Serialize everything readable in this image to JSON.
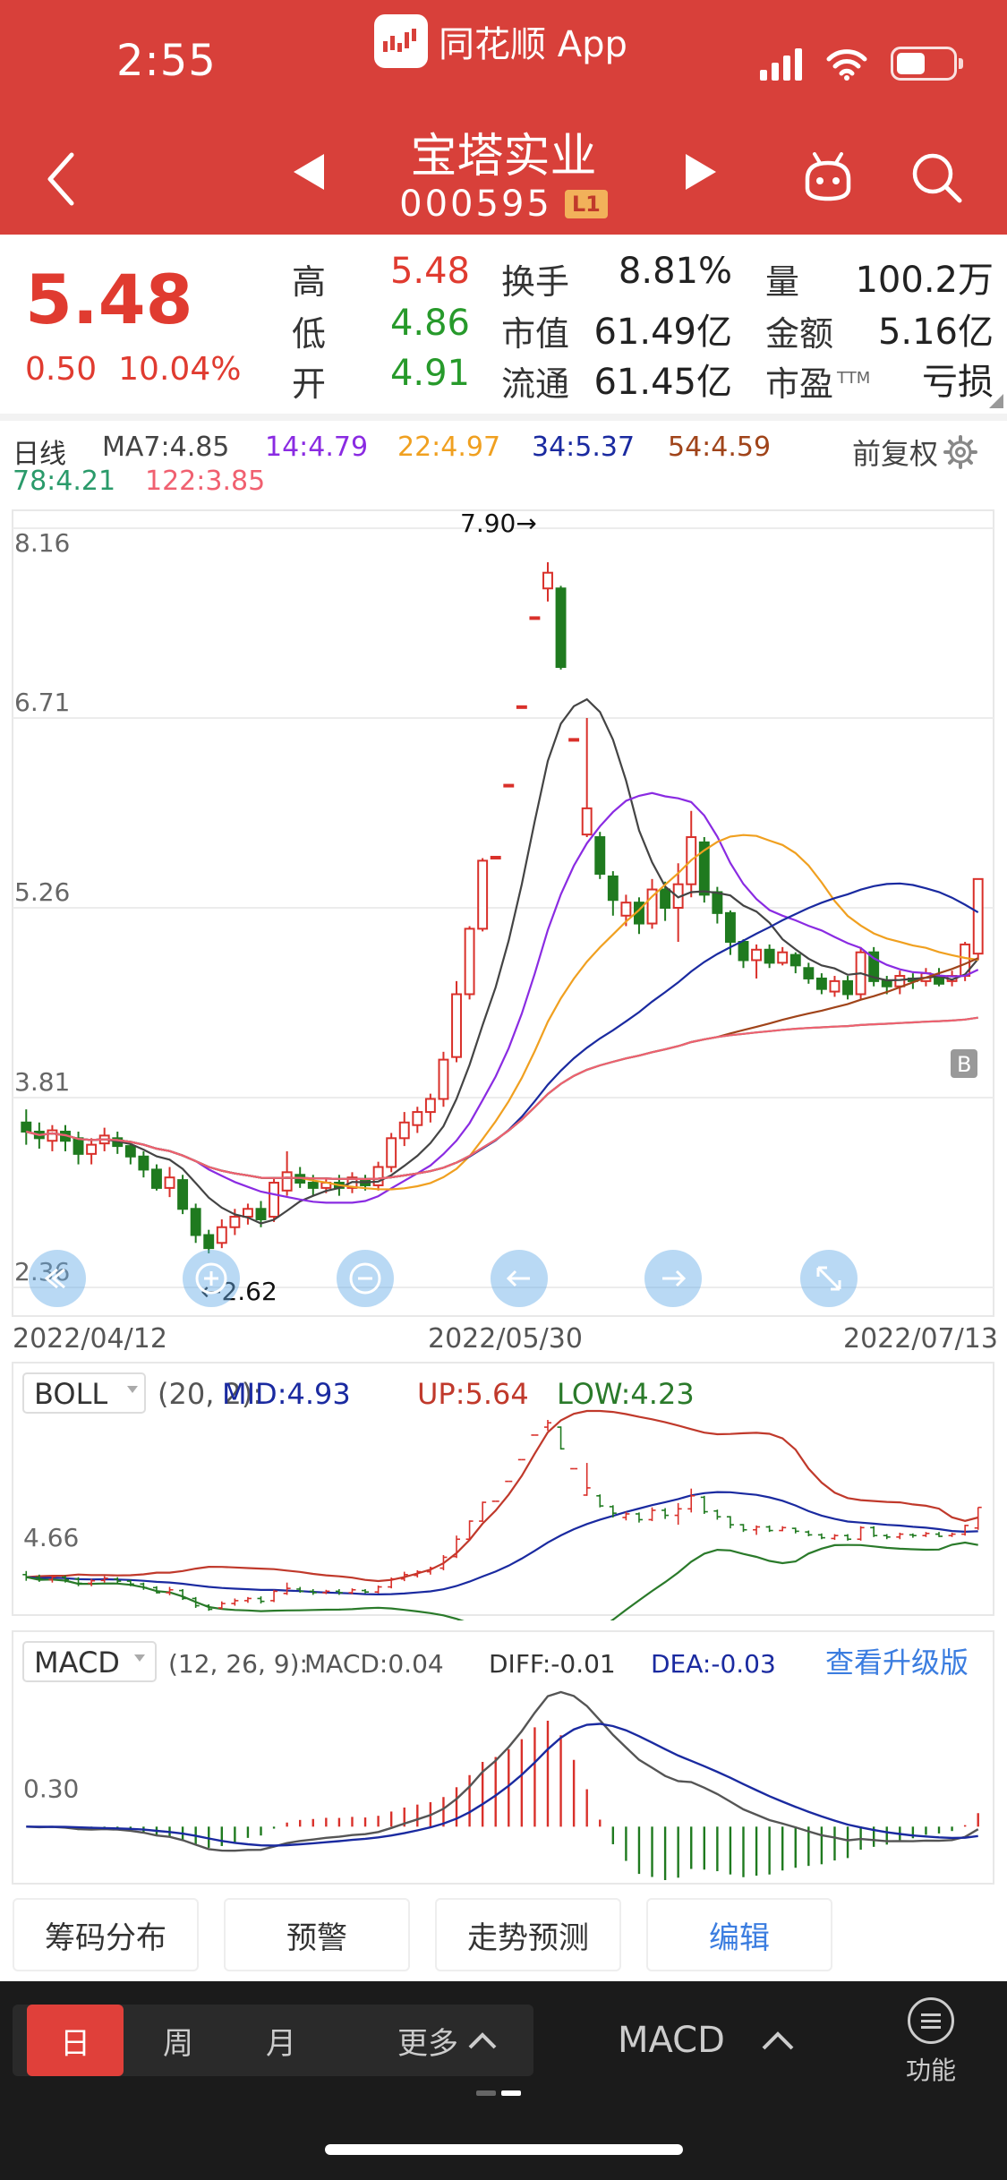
{
  "status": {
    "time": "2:55"
  },
  "app": {
    "name": "同花顺 App"
  },
  "stock": {
    "name": "宝塔实业",
    "code": "000595",
    "level": "L1"
  },
  "quote": {
    "price": "5.48",
    "change": "0.50",
    "change_pct": "10.04%",
    "rows": [
      {
        "l1": "高",
        "v1": "5.48",
        "c1": "red",
        "l2": "换手",
        "v2": "8.81%",
        "l3": "量",
        "v3": "100.2万"
      },
      {
        "l1": "低",
        "v1": "4.86",
        "c1": "green",
        "l2": "市值",
        "v2": "61.49亿",
        "l3": "金额",
        "v3": "5.16亿"
      },
      {
        "l1": "开",
        "v1": "4.91",
        "c1": "green",
        "l2": "流通",
        "v2": "61.45亿",
        "l3": "市盈",
        "l3sup": "TTM",
        "v3": "亏损"
      }
    ]
  },
  "ma_legend": {
    "period": "日线",
    "items": [
      {
        "text": "MA7:4.85",
        "color": "#444444"
      },
      {
        "text": "14:4.79",
        "color": "#8a2be2"
      },
      {
        "text": "22:4.97",
        "color": "#f0a020"
      },
      {
        "text": "34:5.37",
        "color": "#1a2aa0"
      },
      {
        "text": "54:4.59",
        "color": "#a0441a"
      },
      {
        "text": "78:4.21",
        "color": "#2a9a6a"
      },
      {
        "text": "122:3.85",
        "color": "#f06070"
      }
    ],
    "adjust": "前复权"
  },
  "chart_data": {
    "type": "candlestick",
    "y_ticks": [
      "8.16",
      "6.71",
      "5.26",
      "3.81",
      "2.36"
    ],
    "ylim": [
      2.36,
      8.16
    ],
    "dates": [
      "2022/04/12",
      "2022/05/30",
      "2022/07/13"
    ],
    "high_label": "7.90→",
    "low_label": "←2.62",
    "marker": "B",
    "candles": [
      [
        3.62,
        3.55,
        3.72,
        3.45
      ],
      [
        3.55,
        3.5,
        3.62,
        3.42
      ],
      [
        3.48,
        3.56,
        3.6,
        3.4
      ],
      [
        3.55,
        3.48,
        3.6,
        3.4
      ],
      [
        3.5,
        3.38,
        3.55,
        3.3
      ],
      [
        3.38,
        3.45,
        3.5,
        3.3
      ],
      [
        3.46,
        3.52,
        3.58,
        3.4
      ],
      [
        3.5,
        3.44,
        3.55,
        3.38
      ],
      [
        3.44,
        3.36,
        3.48,
        3.3
      ],
      [
        3.36,
        3.26,
        3.4,
        3.2
      ],
      [
        3.26,
        3.12,
        3.3,
        3.1
      ],
      [
        3.12,
        3.2,
        3.28,
        3.05
      ],
      [
        3.18,
        2.96,
        3.22,
        2.92
      ],
      [
        2.96,
        2.76,
        3.0,
        2.7
      ],
      [
        2.76,
        2.66,
        2.8,
        2.62
      ],
      [
        2.7,
        2.82,
        2.88,
        2.66
      ],
      [
        2.82,
        2.9,
        2.96,
        2.76
      ],
      [
        2.9,
        2.96,
        3.0,
        2.84
      ],
      [
        2.96,
        2.88,
        3.02,
        2.82
      ],
      [
        2.9,
        3.16,
        3.2,
        2.86
      ],
      [
        3.1,
        3.24,
        3.4,
        3.06
      ],
      [
        3.22,
        3.16,
        3.28,
        3.12
      ],
      [
        3.16,
        3.12,
        3.22,
        3.06
      ],
      [
        3.12,
        3.16,
        3.2,
        3.08
      ],
      [
        3.16,
        3.12,
        3.22,
        3.06
      ],
      [
        3.12,
        3.2,
        3.24,
        3.08
      ],
      [
        3.18,
        3.14,
        3.22,
        3.1
      ],
      [
        3.14,
        3.28,
        3.32,
        3.1
      ],
      [
        3.28,
        3.5,
        3.54,
        3.24
      ],
      [
        3.5,
        3.62,
        3.7,
        3.44
      ],
      [
        3.6,
        3.7,
        3.74,
        3.54
      ],
      [
        3.7,
        3.8,
        3.84,
        3.62
      ],
      [
        3.8,
        4.1,
        4.16,
        3.74
      ],
      [
        4.12,
        4.6,
        4.7,
        4.08
      ],
      [
        4.6,
        5.1,
        5.12,
        4.56
      ],
      [
        5.1,
        5.62,
        5.64,
        5.08
      ],
      [
        5.65,
        5.65,
        5.65,
        5.65
      ],
      [
        6.2,
        6.2,
        6.2,
        6.2
      ],
      [
        6.8,
        6.8,
        6.8,
        6.8
      ],
      [
        7.48,
        7.48,
        7.48,
        7.48
      ],
      [
        7.7,
        7.82,
        7.9,
        7.6
      ],
      [
        7.7,
        7.1,
        7.72,
        7.08
      ],
      [
        6.55,
        6.55,
        6.55,
        6.55
      ],
      [
        5.82,
        6.02,
        6.71,
        5.8
      ],
      [
        5.8,
        5.52,
        5.84,
        5.48
      ],
      [
        5.5,
        5.32,
        5.54,
        5.2
      ],
      [
        5.2,
        5.3,
        5.36,
        5.12
      ],
      [
        5.3,
        5.14,
        5.34,
        5.06
      ],
      [
        5.14,
        5.4,
        5.48,
        5.1
      ],
      [
        5.4,
        5.26,
        5.46,
        5.16
      ],
      [
        5.26,
        5.44,
        5.6,
        5.0
      ],
      [
        5.44,
        5.8,
        6.0,
        5.34
      ],
      [
        5.76,
        5.36,
        5.8,
        5.3
      ],
      [
        5.38,
        5.22,
        5.42,
        5.14
      ],
      [
        5.22,
        5.0,
        5.24,
        4.9
      ],
      [
        5.0,
        4.86,
        5.02,
        4.8
      ],
      [
        4.86,
        4.94,
        4.98,
        4.72
      ],
      [
        4.94,
        4.84,
        4.98,
        4.8
      ],
      [
        4.84,
        4.92,
        4.96,
        4.82
      ],
      [
        4.9,
        4.82,
        4.92,
        4.76
      ],
      [
        4.8,
        4.72,
        4.84,
        4.68
      ],
      [
        4.72,
        4.64,
        4.76,
        4.6
      ],
      [
        4.62,
        4.7,
        4.74,
        4.58
      ],
      [
        4.7,
        4.6,
        4.74,
        4.56
      ],
      [
        4.6,
        4.92,
        4.96,
        4.56
      ],
      [
        4.92,
        4.7,
        4.96,
        4.66
      ],
      [
        4.7,
        4.66,
        4.74,
        4.6
      ],
      [
        4.66,
        4.74,
        4.78,
        4.6
      ],
      [
        4.72,
        4.7,
        4.76,
        4.64
      ],
      [
        4.7,
        4.76,
        4.8,
        4.66
      ],
      [
        4.74,
        4.68,
        4.8,
        4.66
      ],
      [
        4.7,
        4.74,
        4.78,
        4.66
      ],
      [
        4.74,
        4.98,
        5.0,
        4.7
      ],
      [
        4.91,
        5.48,
        5.48,
        4.86
      ]
    ]
  },
  "boll": {
    "name": "BOLL",
    "params": "(20, 2):",
    "mid": "MID:4.93",
    "up": "UP:5.64",
    "low": "LOW:4.23",
    "tick": "4.66"
  },
  "macd": {
    "name": "MACD",
    "params": "(12, 26, 9):",
    "macd": "MACD:0.04",
    "diff": "DIFF:-0.01",
    "dea": "DEA:-0.03",
    "upgrade": "查看升级版",
    "tick": "0.30"
  },
  "tools": [
    "筹码分布",
    "预警",
    "走势预测",
    "编辑"
  ],
  "footer": {
    "periods": [
      "日",
      "周",
      "月",
      "更多"
    ],
    "indicator": "MACD",
    "func": "功能"
  }
}
